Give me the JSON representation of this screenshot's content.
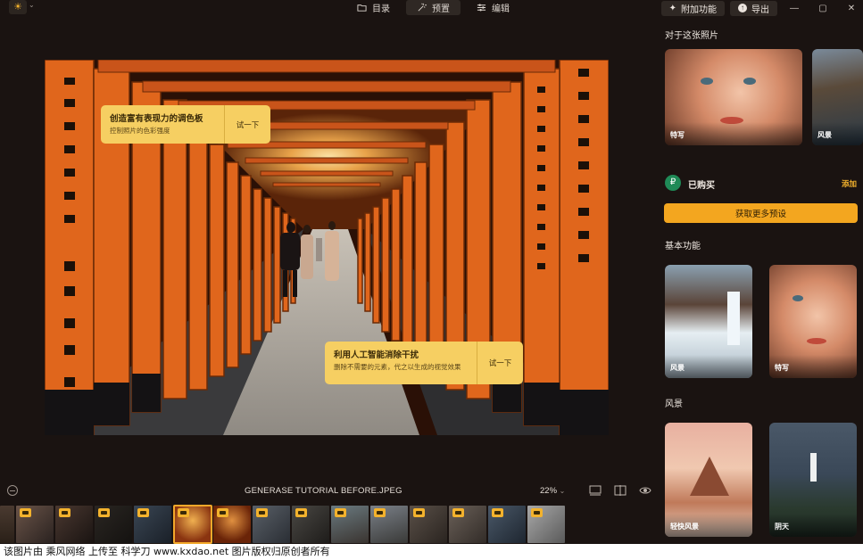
{
  "topbar": {
    "logo_icon": "sun-logo-icon",
    "tabs": [
      {
        "label": "目录",
        "icon": "folder-icon"
      },
      {
        "label": "预置",
        "icon": "magic-wand-icon"
      },
      {
        "label": "编辑",
        "icon": "sliders-icon"
      }
    ],
    "active_tab": "预置",
    "addons_label": "附加功能",
    "export_label": "导出",
    "window_controls": [
      "—",
      "▢",
      "✕"
    ]
  },
  "tooltips": [
    {
      "title": "创造富有表现力的调色板",
      "desc": "控制照片的色彩强度",
      "action": "试一下"
    },
    {
      "title": "利用人工智能消除干扰",
      "desc": "删除不需要的元素，代之以生成的视觉效果",
      "action": "试一下"
    }
  ],
  "status": {
    "filename": "GENERASE TUTORIAL BEFORE.JPEG",
    "zoom": "22%",
    "zoom_caret": "⌄"
  },
  "sidebar": {
    "about_title": "对于这张照片",
    "about_cards": [
      {
        "label": "特写",
        "icon": "portrait-thumbnail"
      },
      {
        "label": "风景",
        "icon": "landscape-thumbnail"
      }
    ],
    "bought_label": "已购买",
    "bought_icon": "₽",
    "add_label": "添加",
    "get_more_label": "获取更多预设",
    "basic_title": "基本功能",
    "basic_cards": [
      {
        "label": "风景",
        "icon": "waterfall-thumbnail"
      },
      {
        "label": "特写",
        "icon": "portrait-thumbnail"
      }
    ],
    "landscape_title": "风景",
    "landscape_cards": [
      {
        "label": "轻快风景",
        "icon": "rock-sea-thumbnail"
      },
      {
        "label": "阴天",
        "icon": "lighthouse-thumbnail"
      }
    ]
  },
  "colors": {
    "accent": "#f3a61f",
    "tooltip_bg": "#f6cf62",
    "background": "#1a1311",
    "torii_orange": "#e0661c"
  },
  "watermark": "该图片由 乘风网络 上传至 科学刀 www.kxdao.net 图片版权归原创者所有"
}
